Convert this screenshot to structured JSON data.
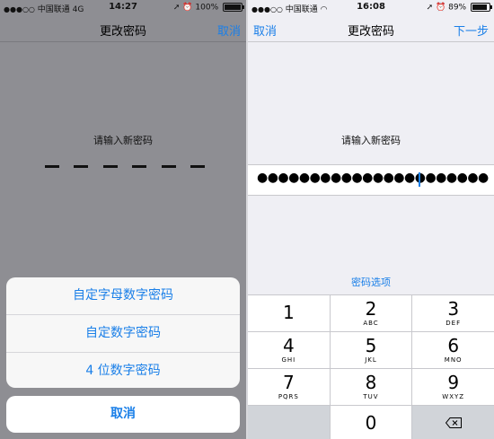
{
  "left": {
    "status": {
      "signal": "●●●○○",
      "carrier": "中国联通",
      "network": "4G",
      "time": "14:27",
      "battery": "100%"
    },
    "nav": {
      "title": "更改密码",
      "right_button": "取消"
    },
    "prompt": "请输入新密码",
    "action_sheet": {
      "options": [
        "自定字母数字密码",
        "自定数字密码",
        "4 位数字密码"
      ],
      "cancel": "取消"
    }
  },
  "right": {
    "status": {
      "signal": "●●●○○",
      "carrier": "中国联通",
      "time": "16:08",
      "battery": "89%"
    },
    "nav": {
      "left_button": "取消",
      "title": "更改密码",
      "right_button": "下一步"
    },
    "prompt": "请输入新密码",
    "password_value": "●●●●●●●●●●●●●●●●●●●●●●",
    "options_link": "密码选项",
    "keypad": [
      [
        {
          "num": "1",
          "letters": ""
        },
        {
          "num": "2",
          "letters": "ABC"
        },
        {
          "num": "3",
          "letters": "DEF"
        }
      ],
      [
        {
          "num": "4",
          "letters": "GHI"
        },
        {
          "num": "5",
          "letters": "JKL"
        },
        {
          "num": "6",
          "letters": "MNO"
        }
      ],
      [
        {
          "num": "7",
          "letters": "PQRS"
        },
        {
          "num": "8",
          "letters": "TUV"
        },
        {
          "num": "9",
          "letters": "WXYZ"
        }
      ],
      [
        {
          "num": "",
          "letters": ""
        },
        {
          "num": "0",
          "letters": ""
        },
        {
          "num": "",
          "letters": ""
        }
      ]
    ]
  },
  "colors": {
    "accent": "#1a7fe8",
    "dim_background": "#8e8e93",
    "page_background": "#efeff4"
  }
}
